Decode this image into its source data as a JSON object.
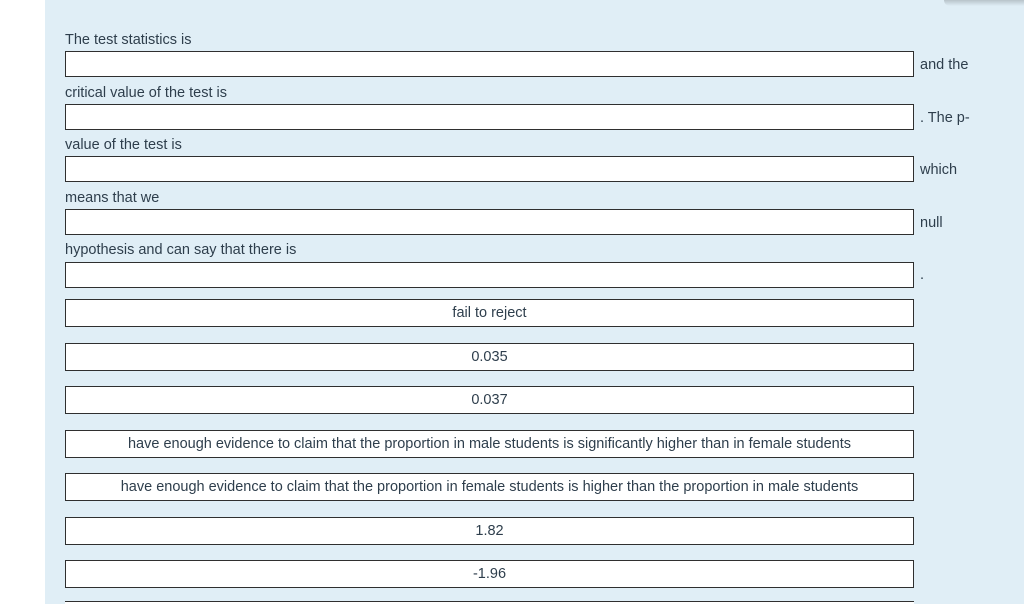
{
  "question": {
    "segments": [
      {
        "prompt": "The test statistics is",
        "suffix": "and the"
      },
      {
        "prompt": "critical value of the test is",
        "suffix": ". The p-"
      },
      {
        "prompt": "value of the test is",
        "suffix": "which"
      },
      {
        "prompt": "means that we",
        "suffix": "null"
      },
      {
        "prompt": "hypothesis and can say that there is",
        "suffix": "."
      }
    ]
  },
  "choices": [
    "fail to reject",
    "0.035",
    "0.037",
    "have enough evidence to claim that the proportion in male students is significantly higher than in female students",
    "have enough evidence to claim that the proportion in female students is higher than the proportion in male students",
    "1.82",
    "-1.96"
  ]
}
